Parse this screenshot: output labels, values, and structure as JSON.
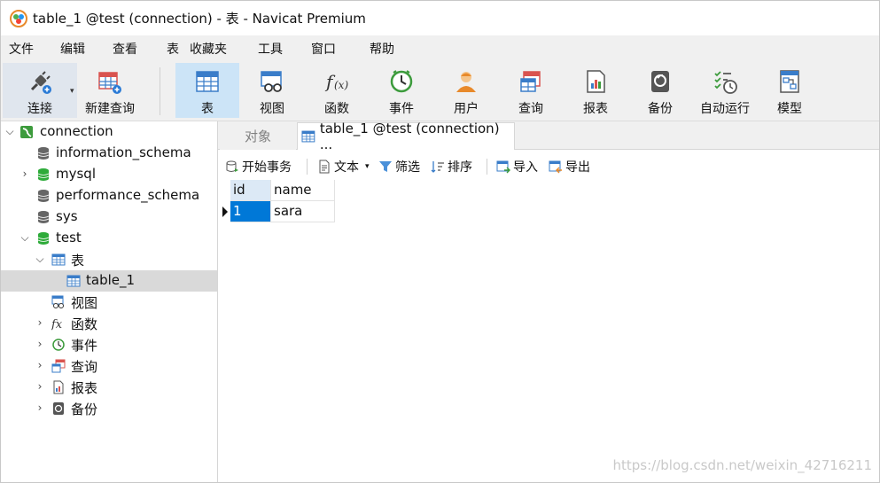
{
  "window": {
    "title": "table_1 @test (connection) - 表 - Navicat Premium"
  },
  "menu": {
    "items": [
      "文件",
      "编辑",
      "查看",
      "表",
      "收藏夹",
      "工具",
      "窗口",
      "帮助"
    ]
  },
  "toolbar": {
    "connect": "连接",
    "new_query": "新建查询",
    "table": "表",
    "view": "视图",
    "function": "函数",
    "event": "事件",
    "user": "用户",
    "query": "查询",
    "report": "报表",
    "backup": "备份",
    "automation": "自动运行",
    "model": "模型"
  },
  "sidebar": {
    "nodes": [
      {
        "label": "connection"
      },
      {
        "label": "information_schema"
      },
      {
        "label": "mysql"
      },
      {
        "label": "performance_schema"
      },
      {
        "label": "sys"
      },
      {
        "label": "test"
      },
      {
        "label": "表"
      },
      {
        "label": "table_1"
      },
      {
        "label": "视图"
      },
      {
        "label": "函数"
      },
      {
        "label": "事件"
      },
      {
        "label": "查询"
      },
      {
        "label": "报表"
      },
      {
        "label": "备份"
      }
    ]
  },
  "tabs": {
    "objects": "对象",
    "current": "table_1 @test (connection) ..."
  },
  "subtoolbar": {
    "begin_transaction": "开始事务",
    "text": "文本",
    "filter": "筛选",
    "sort": "排序",
    "import": "导入",
    "export": "导出"
  },
  "grid": {
    "columns": [
      "id",
      "name"
    ],
    "rows": [
      [
        "1",
        "sara"
      ]
    ]
  },
  "watermark": "https://blog.csdn.net/weixin_42716211",
  "colors": {
    "selection": "#0078d7",
    "toolbar_active": "#cce4f7",
    "db_green": "#2eab3a",
    "table_blue": "#3a7dc9"
  }
}
